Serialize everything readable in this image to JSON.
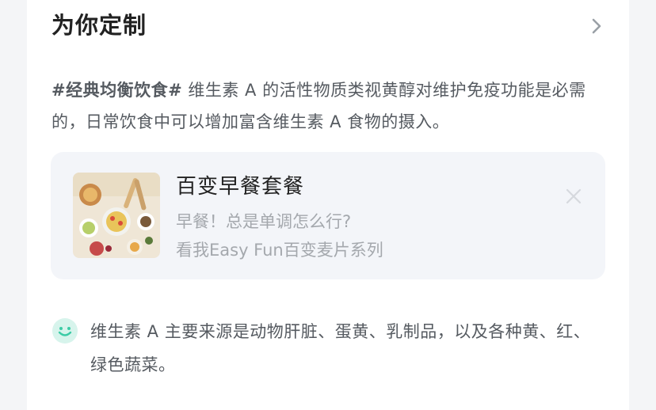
{
  "section": {
    "title": "为你定制",
    "chevron_icon": "chevron-right-icon"
  },
  "description": {
    "tag": "#经典均衡饮食#",
    "text": " 维生素 A 的活性物质类视黄醇对维护免疫功能是必需的，日常饮食中可以增加富含维生素 A 食物的摄入。"
  },
  "promo_card": {
    "image_icon": "food-photo",
    "title": "百变早餐套餐",
    "line1": "早餐！总是单调怎么行?",
    "line2": "看我Easy Fun百变麦片系列",
    "close_icon": "close-icon"
  },
  "tip": {
    "icon": "smile-icon",
    "text": "维生素 A 主要来源是动物肝脏、蛋黄、乳制品，以及各种黄、红、绿色蔬菜。"
  },
  "colors": {
    "accent": "#3ccba6",
    "text_primary": "#222222",
    "text_secondary": "#555a60",
    "text_muted": "#a4a8ad",
    "card_bg": "#f3f5f9"
  }
}
